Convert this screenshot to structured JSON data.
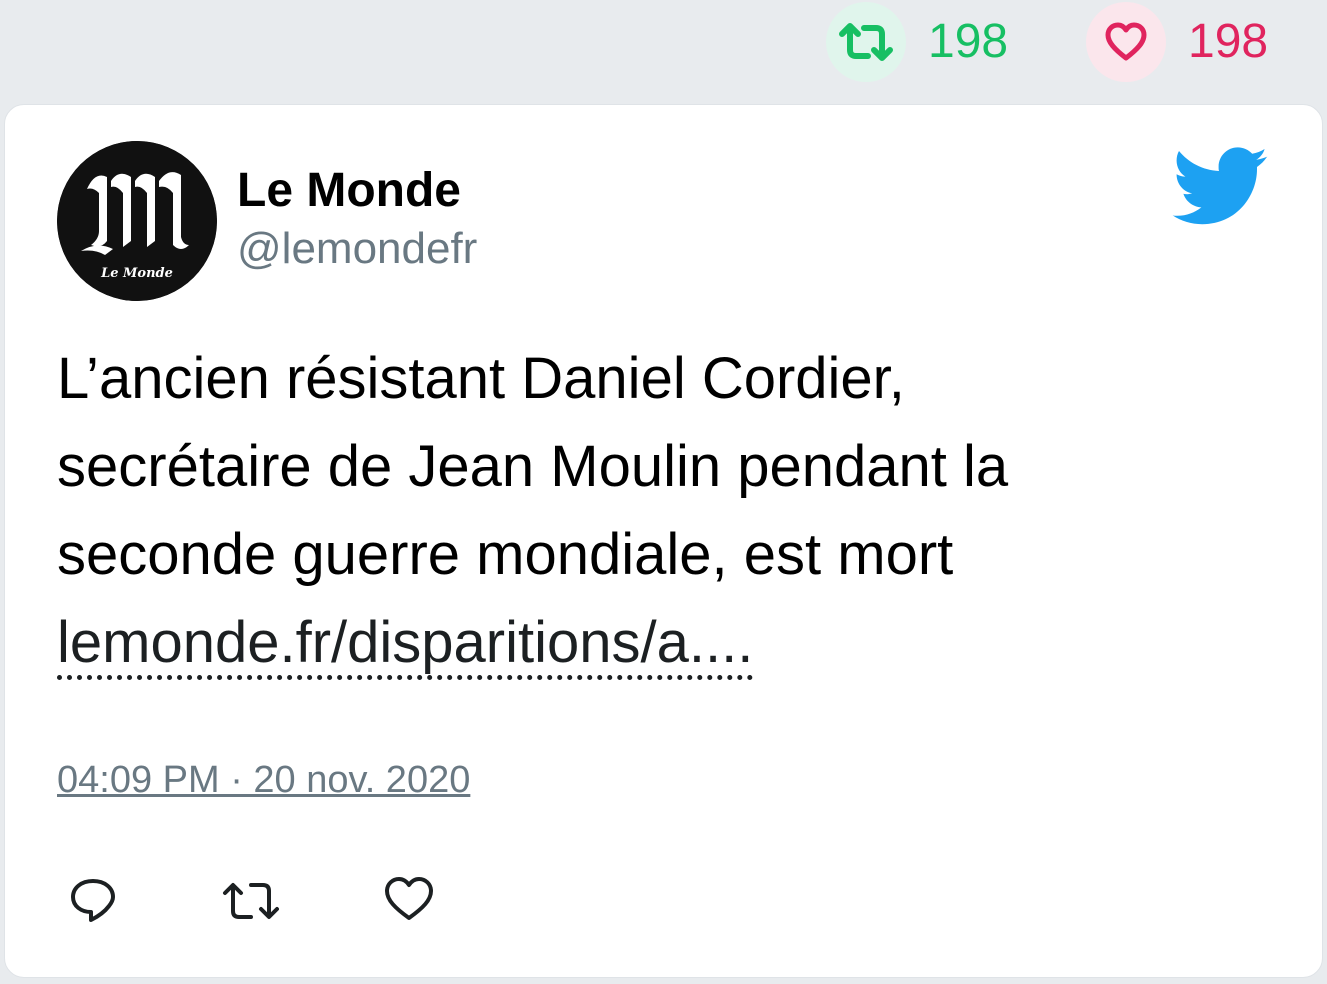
{
  "stats": {
    "retweets": "198",
    "likes": "198",
    "retweet_color": "#17bf63",
    "like_color": "#e0245e"
  },
  "author": {
    "name": "Le Monde",
    "handle": "@lemondefr",
    "avatar_icon": "le-monde-logo"
  },
  "tweet": {
    "text_lines": [
      "L’ancien résistant Daniel Cordier,",
      "secrétaire de Jean Moulin pendant la",
      "seconde guerre mondiale, est mort"
    ],
    "link": "lemonde.fr/disparitions/a....",
    "timestamp": "04:09 PM · 20 nov. 2020"
  },
  "actions": [
    "reply-icon",
    "retweet-icon",
    "like-icon"
  ],
  "brand": {
    "twitter_blue": "#1da1f2"
  }
}
